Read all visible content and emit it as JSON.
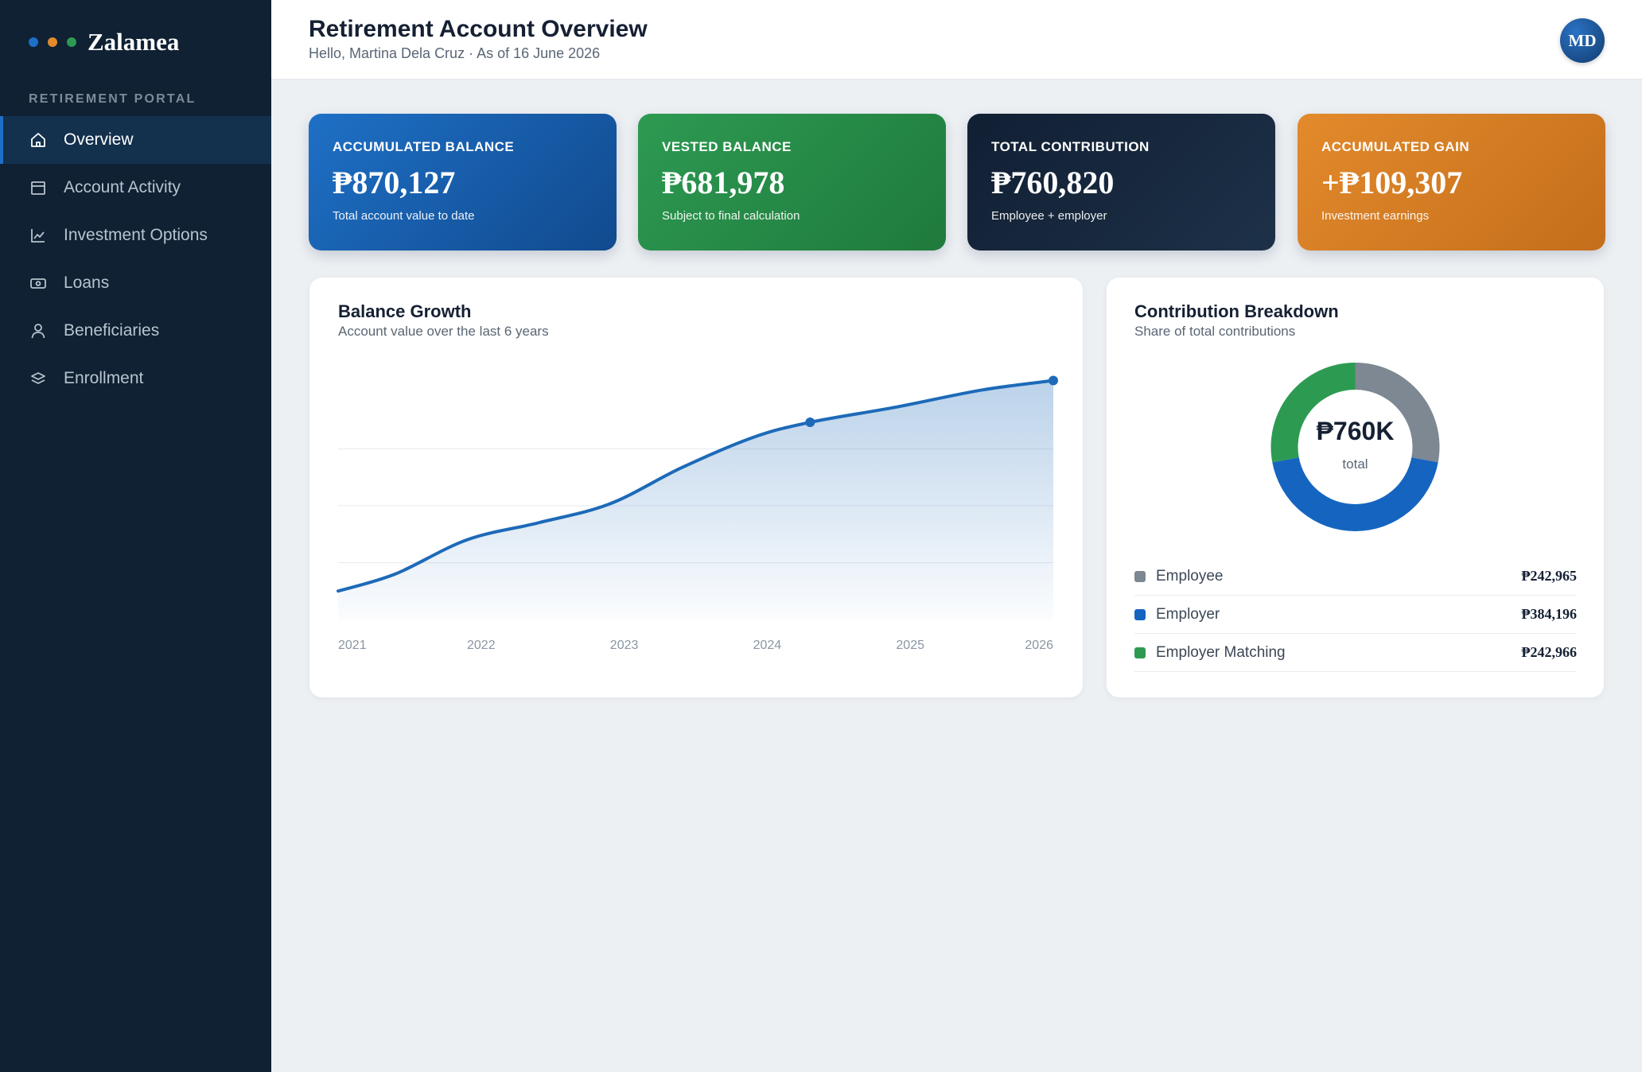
{
  "brand": {
    "name": "Zalamea",
    "dot_colors": [
      "#1e6fc8",
      "#e38a2c",
      "#2d9a52"
    ]
  },
  "sidebar": {
    "section_label": "RETIREMENT PORTAL",
    "items": [
      {
        "label": "Overview",
        "icon": "home-icon",
        "active": true
      },
      {
        "label": "Account Activity",
        "icon": "calendar-icon",
        "active": false
      },
      {
        "label": "Investment Options",
        "icon": "chart-line-icon",
        "active": false
      },
      {
        "label": "Loans",
        "icon": "cash-icon",
        "active": false
      },
      {
        "label": "Beneficiaries",
        "icon": "user-icon",
        "active": false
      },
      {
        "label": "Enrollment",
        "icon": "layers-icon",
        "active": false
      }
    ]
  },
  "header": {
    "title": "Retirement Account Overview",
    "subtitle": "Hello, Martina Dela Cruz · As of 16 June 2026",
    "avatar_initials": "MD"
  },
  "cards": [
    {
      "label": "ACCUMULATED BALANCE",
      "value": "₱870,127",
      "sub": "Total account value to date",
      "color": "#1e70c6"
    },
    {
      "label": "VESTED BALANCE",
      "value": "₱681,978",
      "sub": "Subject to final calculation",
      "color": "#2d9a52"
    },
    {
      "label": "TOTAL CONTRIBUTION",
      "value": "₱760,820",
      "sub": "Employee + employer",
      "color": "#111f33"
    },
    {
      "label": "ACCUMULATED GAIN",
      "value": "+₱109,307",
      "sub": "Investment earnings",
      "color": "#e38a2c"
    }
  ],
  "growth": {
    "title": "Balance Growth",
    "subtitle": "Account value over the last 6 years"
  },
  "breakdown": {
    "title": "Contribution Breakdown",
    "subtitle": "Share of total contributions",
    "center_value": "₱760K",
    "center_label": "total",
    "items": [
      {
        "name": "Employee",
        "value": "₱242,965",
        "color": "#7d8893"
      },
      {
        "name": "Employer",
        "value": "₱384,196",
        "color": "#1565c0"
      },
      {
        "name": "Employer Matching",
        "value": "₱242,966",
        "color": "#2d9a52"
      }
    ]
  },
  "chart_data": [
    {
      "type": "area",
      "x": [
        "2021",
        "2022",
        "2023",
        "2024",
        "2025",
        "2026"
      ],
      "x_values": [
        2021,
        2021.4,
        2021.9,
        2022.4,
        2022.9,
        2023.4,
        2023.9,
        2024.3,
        2024.9,
        2025.5,
        2026.0
      ],
      "y_values": [
        0.0,
        0.09,
        0.27,
        0.36,
        0.46,
        0.65,
        0.81,
        0.89,
        0.97,
        1.06,
        1.11
      ],
      "highlight_points": [
        {
          "x": 2024.3,
          "y": 0.89
        },
        {
          "x": 2026.0,
          "y": 1.11
        }
      ],
      "ylim": [
        -0.15,
        1.15
      ],
      "grid": true,
      "line_color": "#1d6ab8"
    },
    {
      "type": "pie",
      "labels": [
        "Employee",
        "Employer",
        "Employer Matching"
      ],
      "values": [
        242965,
        384196,
        242966
      ],
      "colors": [
        "#7d8893",
        "#1565c0",
        "#2d9a52"
      ]
    }
  ]
}
